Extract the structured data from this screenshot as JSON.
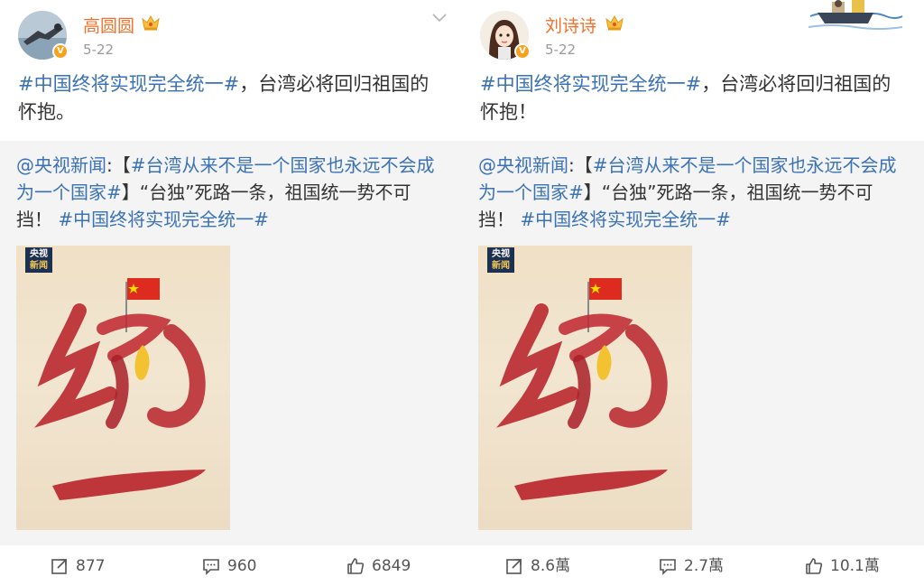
{
  "posts": [
    {
      "username": "高圆圆",
      "date": "5-22",
      "tag": "#中国终将实现完全统一#",
      "text": "，台湾必将回归祖国的怀抱。",
      "repost": {
        "link": "@央视新闻",
        "colon": ":",
        "bracket_open": "【",
        "tag1": "#台湾从来不是一个国家也永远不会成为一个国家#",
        "bracket_close": "】",
        "body": "“台独”死路一条，祖国统一势不可挡！ ",
        "tag2": "#中国终将实现完全统一#"
      },
      "poster": {
        "logo_line1": "央视",
        "logo_line2": "新闻"
      },
      "actions": {
        "share": "877",
        "comment": "960",
        "like": "6849"
      }
    },
    {
      "username": "刘诗诗",
      "date": "5-22",
      "tag": "#中国终将实现完全统一#",
      "text": "，台湾必将回归祖国的怀抱！",
      "repost": {
        "link": "@央视新闻",
        "colon": ":",
        "bracket_open": "【",
        "tag1": "#台湾从来不是一个国家也永远不会成为一个国家#",
        "bracket_close": "】",
        "body": "“台独”死路一条，祖国统一势不可挡！ ",
        "tag2": "#中国终将实现完全统一#"
      },
      "poster": {
        "logo_line1": "央视",
        "logo_line2": "新闻"
      },
      "actions": {
        "share": "8.6萬",
        "comment": "2.7萬",
        "like": "10.1萬"
      }
    }
  ],
  "colors": {
    "link": "#3b72b6",
    "username": "#f27029",
    "repost_bg": "#f4f4f4",
    "verify": "#f6a21c"
  },
  "icons": [
    "share-icon",
    "comment-icon",
    "like-icon",
    "chevron-down-icon",
    "crown-icon",
    "verified-icon"
  ]
}
